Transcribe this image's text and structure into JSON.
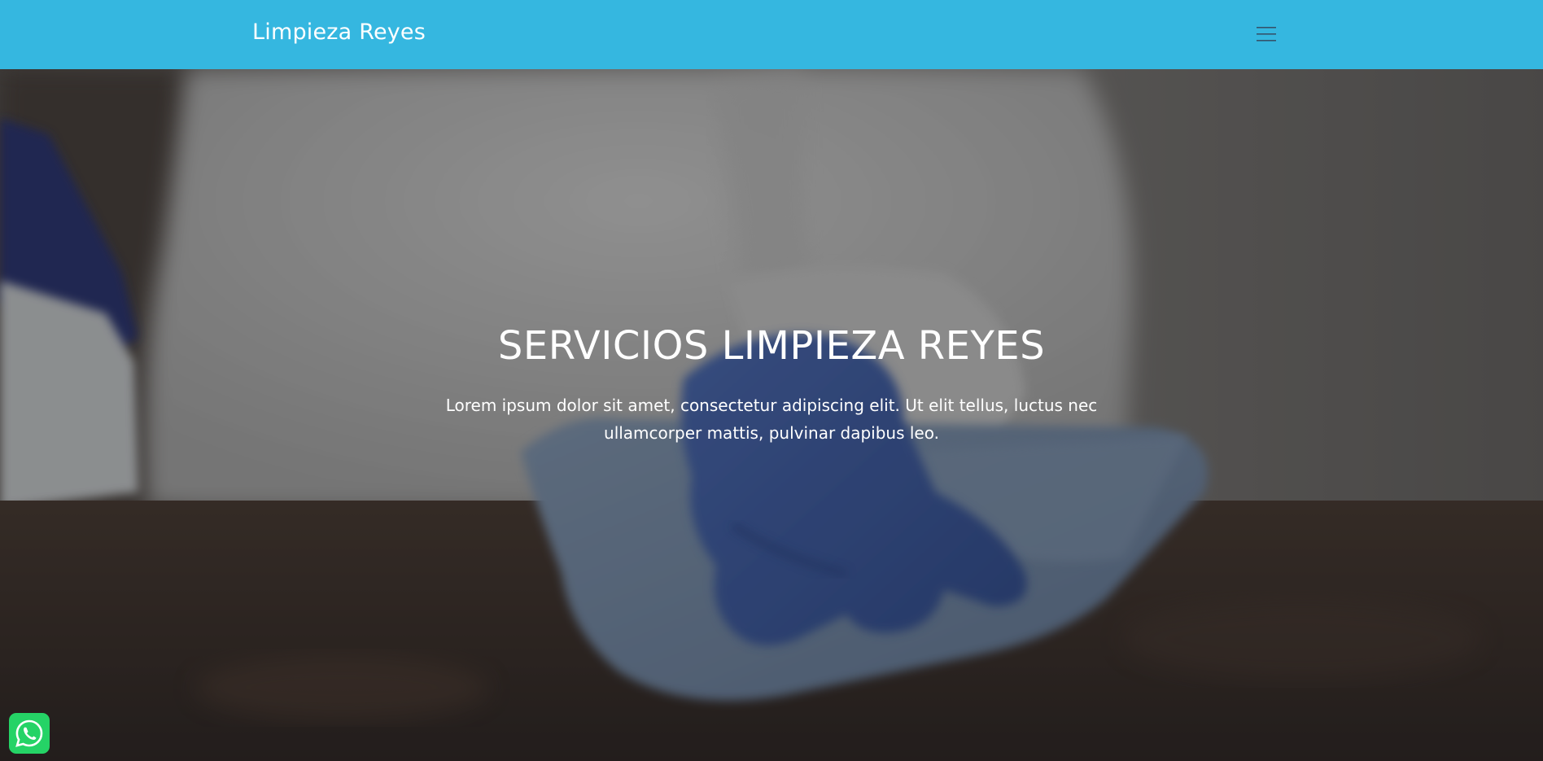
{
  "navbar": {
    "brand": "Limpieza Reyes",
    "menu_icon": "hamburger-icon",
    "background_color": "#35b7e0"
  },
  "hero": {
    "title": "SERVICIOS LIMPIEZA REYES",
    "text": "Lorem ipsum dolor sit amet, consectetur adipiscing elit. Ut elit tellus, luctus nec ullamcorper mattis, pulvinar dapibus leo.",
    "background_image": "cleaning-gloved-hand-wiping-table"
  },
  "whatsapp": {
    "icon": "whatsapp-icon",
    "color": "#25d366"
  }
}
